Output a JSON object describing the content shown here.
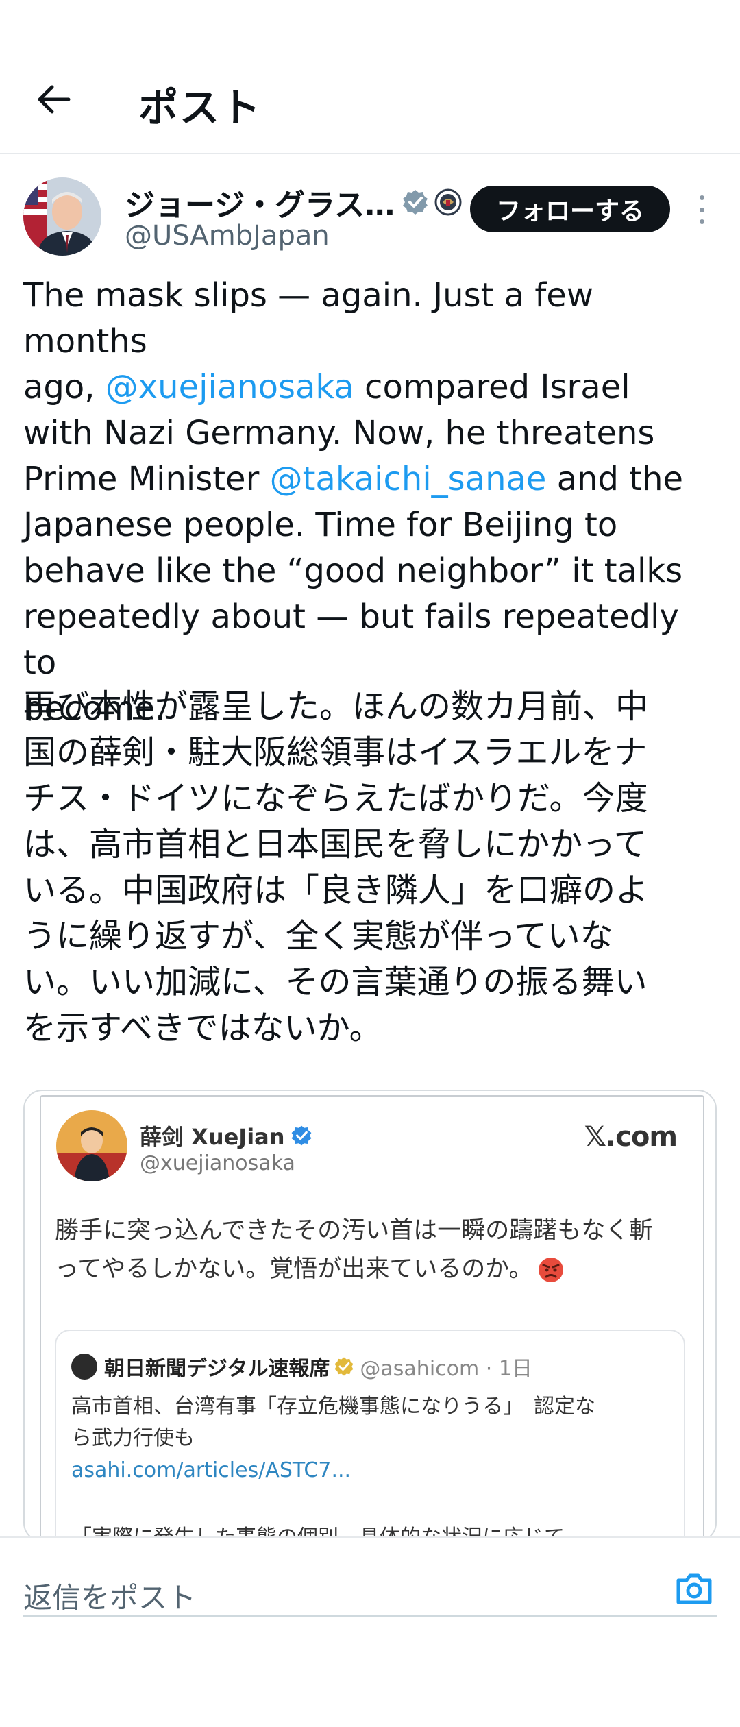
{
  "header": {
    "title": "ポスト"
  },
  "author": {
    "name": "ジョージ・グラス…",
    "handle": "@USAmbJapan",
    "follow_label": "フォローする"
  },
  "tweet": {
    "en_parts": [
      "The mask slips — again. Just a few months\nago, ",
      "@xuejianosaka",
      " compared Israel\nwith Nazi Germany. Now, he threatens\nPrime Minister ",
      "@takaichi_sanae",
      " and the\nJapanese people. Time for Beijing to\nbehave like the “good neighbor” it talks\nrepeatedly about — but fails repeatedly to\nbecome."
    ],
    "jp": "再び本性が露呈した。ほんの数カ月前、中\n国の薛剣・駐大阪総領事はイスラエルをナ\nチス・ドイツになぞらえたばかりだ。今度\nは、高市首相と日本国民を脅しにかかって\nいる。中国政府は「良き隣人」を口癖のよ\nうに繰り返すが、全く実態が伴っていな\nい。いい加減に、その言葉通りの振る舞い\nを示すべきではないか。"
  },
  "embed": {
    "name": "薛剑 XueJian",
    "handle": "@xuejianosaka",
    "site": "𝕏.com",
    "text": "勝手に突っ込んできたその汚い首は一瞬の躊躇もなく斬\nってやるしかない。覚悟が出来ているのか。",
    "quote": {
      "name": "朝日新聞デジタル速報席",
      "handle_time": "@asahicom · 1日",
      "body": "高市首相、台湾有事「存立危機事態になりうる」　認定な\nら武力行使も",
      "link": "asahi.com/articles/ASTC7...",
      "snippet": "「実際に発生した事態の個別、具体的な状況に応じて、…"
    }
  },
  "reply": {
    "placeholder": "返信をポスト"
  },
  "colors": {
    "accent": "#1d9bf0",
    "text": "#0f1419",
    "muted": "#536471"
  },
  "icons": [
    "back-arrow-icon",
    "verified-badge-icon",
    "government-badge-icon",
    "more-icon",
    "angry-face-icon",
    "camera-icon"
  ]
}
